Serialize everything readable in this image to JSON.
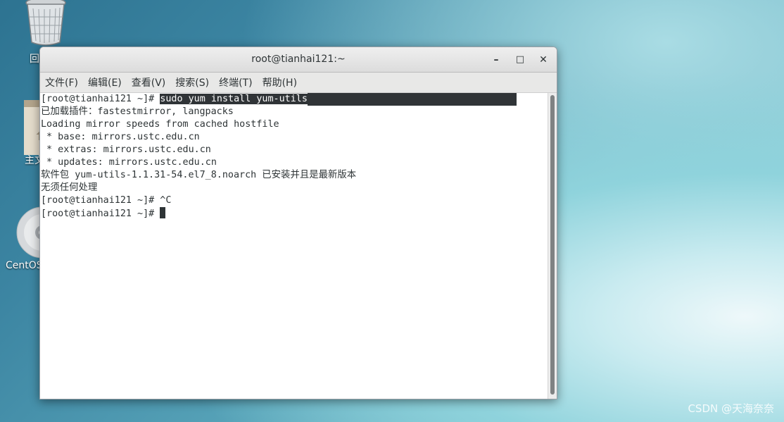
{
  "desktop": {
    "icons": [
      {
        "name": "trash",
        "label": "回"
      },
      {
        "name": "home-folder",
        "label": "主文"
      },
      {
        "name": "centos-disc",
        "label": "CentOS"
      }
    ],
    "watermark": "CSDN @天海奈奈"
  },
  "window": {
    "title": "root@tianhai121:~",
    "controls": {
      "minimize": "–",
      "maximize": "□",
      "close": "✕"
    },
    "menu": [
      "文件(F)",
      "编辑(E)",
      "查看(V)",
      "搜索(S)",
      "终端(T)",
      "帮助(H)"
    ]
  },
  "terminal": {
    "line1_prompt": "[root@tianhai121 ~]# ",
    "line1_cmd": "sudo yum install yum-utils",
    "lines": [
      "已加载插件：fastestmirror, langpacks",
      "Loading mirror speeds from cached hostfile",
      " * base: mirrors.ustc.edu.cn",
      " * extras: mirrors.ustc.edu.cn",
      " * updates: mirrors.ustc.edu.cn",
      "软件包 yum-utils-1.1.31-54.el7_8.noarch 已安装并且是最新版本",
      "无须任何处理",
      "[root@tianhai121 ~]# ^C"
    ],
    "last_prompt": "[root@tianhai121 ~]# "
  }
}
